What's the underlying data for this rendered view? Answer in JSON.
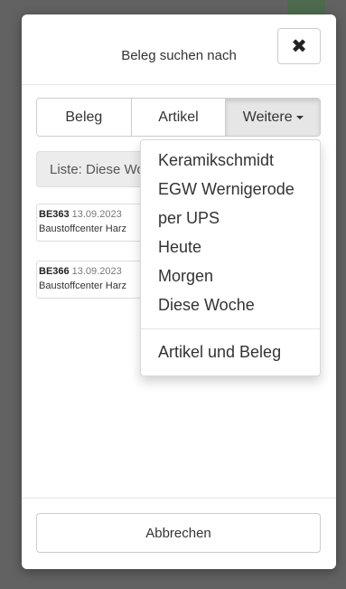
{
  "modal": {
    "title": "Beleg suchen nach",
    "close_icon": "close-icon"
  },
  "tabs": [
    {
      "label": "Beleg",
      "active": false
    },
    {
      "label": "Artikel",
      "active": false
    },
    {
      "label": "Weitere",
      "active": true
    }
  ],
  "list_bar": {
    "text": "Liste: Diese Woche"
  },
  "results": [
    {
      "id": "BE363",
      "date": "13.09.2023",
      "customer": "Baustoffcenter Harz"
    },
    {
      "id": "BE366",
      "date": "13.09.2023",
      "customer": "Baustoffcenter Harz"
    }
  ],
  "dropdown": {
    "items": [
      "Keramikschmidt",
      "EGW Wernigerode",
      "per UPS",
      "Heute",
      "Morgen",
      "Diese Woche"
    ],
    "after_divider": "Artikel und Beleg"
  },
  "footer": {
    "cancel_label": "Abbrechen"
  }
}
